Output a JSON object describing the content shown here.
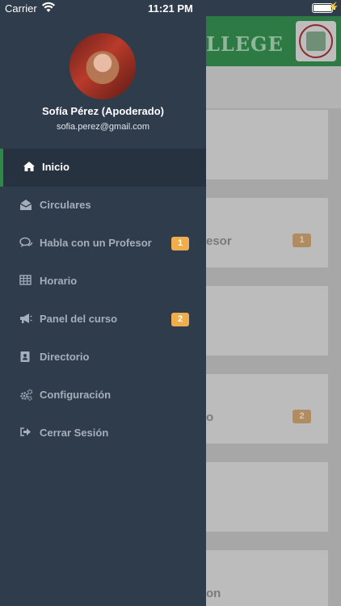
{
  "status_bar": {
    "carrier": "Carrier",
    "time": "11:21 PM"
  },
  "background": {
    "title_fragment": "LLEGE",
    "cards": [
      {
        "text": "",
        "badge": ""
      },
      {
        "text": "esor",
        "badge": "1"
      },
      {
        "text": "",
        "badge": ""
      },
      {
        "text": "o",
        "badge": "2"
      },
      {
        "text": "",
        "badge": ""
      },
      {
        "text": "on",
        "badge": ""
      }
    ]
  },
  "profile": {
    "name": "Sofía Pérez (Apoderado)",
    "email": "sofia.perez@gmail.com"
  },
  "menu": {
    "items": [
      {
        "label": "Inicio",
        "icon": "home-icon",
        "active": true,
        "badge": ""
      },
      {
        "label": "Circulares",
        "icon": "envelope-open-icon",
        "active": false,
        "badge": ""
      },
      {
        "label": "Habla con un Profesor",
        "icon": "chat-icon",
        "active": false,
        "badge": "1"
      },
      {
        "label": "Horario",
        "icon": "table-icon",
        "active": false,
        "badge": ""
      },
      {
        "label": "Panel del curso",
        "icon": "megaphone-icon",
        "active": false,
        "badge": "2"
      },
      {
        "label": "Directorio",
        "icon": "address-book-icon",
        "active": false,
        "badge": ""
      },
      {
        "label": "Configuración",
        "icon": "gears-icon",
        "active": false,
        "badge": ""
      },
      {
        "label": "Cerrar Sesión",
        "icon": "sign-out-icon",
        "active": false,
        "badge": ""
      }
    ]
  },
  "colors": {
    "drawer_bg": "#2e3c4b",
    "active_bg": "#26323f",
    "active_accent": "#2c8a45",
    "badge": "#f0ad4e",
    "header_green": "#2d7a44"
  }
}
